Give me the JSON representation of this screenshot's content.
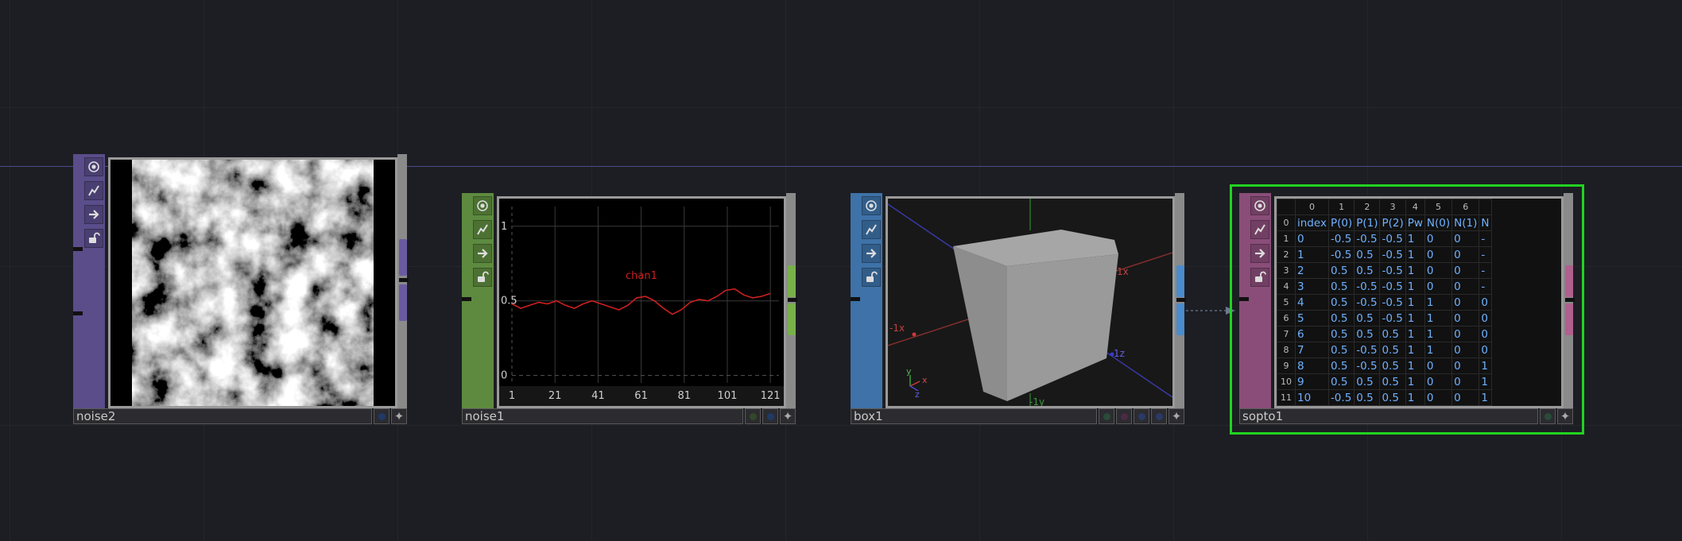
{
  "nodes": {
    "noise2": {
      "name": "noise2",
      "sidebar_color": "#5a4d8a",
      "port_color": "#6a5aa0"
    },
    "noise1": {
      "name": "noise1",
      "sidebar_color": "#5d8a3f",
      "port_color": "#78b04a",
      "chart_data": {
        "type": "line",
        "series": [
          {
            "name": "chan1",
            "values": [
              0.48,
              0.45,
              0.47,
              0.49,
              0.48,
              0.5,
              0.47,
              0.45,
              0.48,
              0.5,
              0.48,
              0.46,
              0.44,
              0.47,
              0.52,
              0.53,
              0.5,
              0.45,
              0.41,
              0.44,
              0.49,
              0.51,
              0.5,
              0.53,
              0.57,
              0.58,
              0.54,
              0.52,
              0.53,
              0.55
            ]
          }
        ],
        "x_ticks": [
          "1",
          "21",
          "41",
          "61",
          "81",
          "101",
          "121"
        ],
        "y_ticks": [
          "1",
          "0.5",
          "0"
        ],
        "xlim": [
          1,
          125
        ],
        "ylim": [
          -0.05,
          1.1
        ],
        "line_color": "#cc1f1f"
      }
    },
    "box1": {
      "name": "box1",
      "sidebar_color": "#3e72a8",
      "port_color": "#4a8ccc",
      "axis_labels": {
        "neg_x": "-1x",
        "pos_x": "1x",
        "pos_z": "1z",
        "neg_y": "-1y"
      },
      "gizmo": {
        "x": "x",
        "y": "y",
        "z": "z"
      }
    },
    "sopto1": {
      "name": "sopto1",
      "sidebar_color": "#8a4d79",
      "port_color": "#b0608f",
      "selected_color": "#21d321",
      "table": {
        "col_index": [
          "0",
          "1",
          "2",
          "3",
          "4",
          "5",
          "6",
          ""
        ],
        "header": [
          "index",
          "P(0)",
          "P(1)",
          "P(2)",
          "Pw",
          "N(0)",
          "N(1)",
          "N"
        ],
        "rows": [
          {
            "i": "1",
            "cells": [
              "0",
              "-0.5",
              "-0.5",
              "-0.5",
              "1",
              "0",
              "0",
              "-"
            ]
          },
          {
            "i": "2",
            "cells": [
              "1",
              "-0.5",
              "0.5",
              "-0.5",
              "1",
              "0",
              "0",
              "-"
            ]
          },
          {
            "i": "3",
            "cells": [
              "2",
              "0.5",
              "0.5",
              "-0.5",
              "1",
              "0",
              "0",
              "-"
            ]
          },
          {
            "i": "4",
            "cells": [
              "3",
              "0.5",
              "-0.5",
              "-0.5",
              "1",
              "0",
              "0",
              "-"
            ]
          },
          {
            "i": "5",
            "cells": [
              "4",
              "0.5",
              "-0.5",
              "-0.5",
              "1",
              "1",
              "0",
              "0"
            ]
          },
          {
            "i": "6",
            "cells": [
              "5",
              "0.5",
              "0.5",
              "-0.5",
              "1",
              "1",
              "0",
              "0"
            ]
          },
          {
            "i": "7",
            "cells": [
              "6",
              "0.5",
              "0.5",
              "0.5",
              "1",
              "1",
              "0",
              "0"
            ]
          },
          {
            "i": "8",
            "cells": [
              "7",
              "0.5",
              "-0.5",
              "0.5",
              "1",
              "1",
              "0",
              "0"
            ]
          },
          {
            "i": "9",
            "cells": [
              "8",
              "0.5",
              "-0.5",
              "0.5",
              "1",
              "0",
              "0",
              "1"
            ]
          },
          {
            "i": "10",
            "cells": [
              "9",
              "0.5",
              "0.5",
              "0.5",
              "1",
              "0",
              "0",
              "1"
            ]
          },
          {
            "i": "11",
            "cells": [
              "10",
              "-0.5",
              "0.5",
              "0.5",
              "1",
              "0",
              "0",
              "1"
            ]
          }
        ]
      }
    }
  },
  "icons": [
    "viewer-toggle-icon",
    "graph-icon",
    "arrow-right-icon",
    "lock-icon",
    "plus-icon"
  ]
}
